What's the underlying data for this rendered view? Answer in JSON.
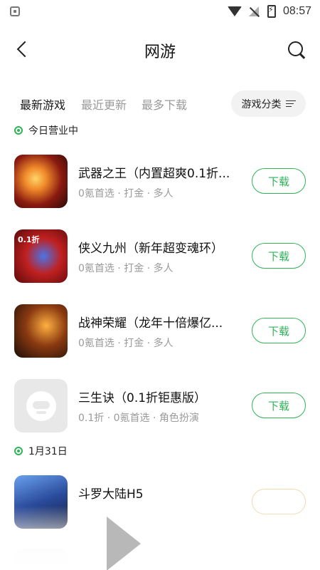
{
  "status_bar": {
    "time": "08:57"
  },
  "header": {
    "title": "网游"
  },
  "tabs": [
    {
      "label": "最新游戏",
      "active": true
    },
    {
      "label": "最近更新",
      "active": false
    },
    {
      "label": "最多下载",
      "active": false
    }
  ],
  "filter": {
    "label": "游戏分类"
  },
  "sections": [
    {
      "label": "今日营业中"
    },
    {
      "label": "1月31日"
    }
  ],
  "games": [
    {
      "name": "武器之王（内置超爽0.1折...",
      "tags": "0氪首选 · 打金 · 多人",
      "button": "下载",
      "icon": "game-icon-weapon-king"
    },
    {
      "name": "侠义九州（新年超变魂环）",
      "tags": "0氪首选 · 打金 · 多人",
      "button": "下载",
      "icon": "game-icon-xiayi-jiuzhou",
      "badge": "0.1折"
    },
    {
      "name": "战神荣耀（龙年十倍爆亿...",
      "tags": "0氪首选 · 打金 · 多人",
      "button": "下载",
      "icon": "game-icon-zhanshen"
    },
    {
      "name": "三生诀（0.1折钜惠版）",
      "tags": "0.1折 · 0氪首选 · 角色扮演",
      "button": "下载",
      "icon": "placeholder-icon"
    },
    {
      "name": "斗罗大陆H5",
      "tags": "",
      "button": "",
      "icon": "game-icon-douluo"
    }
  ],
  "colors": {
    "accent": "#2fb457",
    "tab_highlight": "#b8ecc7",
    "muted_text": "#9a9a9a"
  }
}
